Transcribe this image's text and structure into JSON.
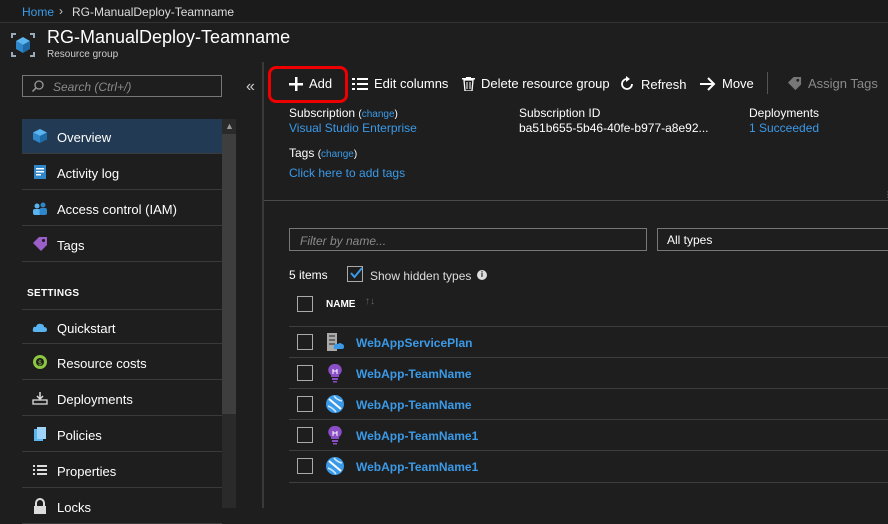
{
  "breadcrumb": {
    "home": "Home",
    "separator": "›",
    "current": "RG-ManualDeploy-Teamname"
  },
  "header": {
    "title": "RG-ManualDeploy-Teamname",
    "subtitle": "Resource group"
  },
  "sidebar": {
    "search_placeholder": "Search (Ctrl+/)",
    "collapse_glyph": "«",
    "settings_heading": "SETTINGS",
    "items": [
      {
        "label": "Overview",
        "icon": "overview-cube-icon",
        "active": true
      },
      {
        "label": "Activity log",
        "icon": "activity-log-icon"
      },
      {
        "label": "Access control (IAM)",
        "icon": "iam-users-icon"
      },
      {
        "label": "Tags",
        "icon": "tag-icon"
      },
      {
        "label": "Quickstart",
        "icon": "cloud-quickstart-icon"
      },
      {
        "label": "Resource costs",
        "icon": "resource-costs-icon"
      },
      {
        "label": "Deployments",
        "icon": "deployments-icon"
      },
      {
        "label": "Policies",
        "icon": "policies-icon"
      },
      {
        "label": "Properties",
        "icon": "properties-icon"
      },
      {
        "label": "Locks",
        "icon": "lock-icon"
      }
    ]
  },
  "toolbar": {
    "add": "Add",
    "edit_columns": "Edit columns",
    "delete_rg": "Delete resource group",
    "refresh": "Refresh",
    "move": "Move",
    "assign_tags": "Assign Tags"
  },
  "essentials": {
    "subscription_label": "Subscription",
    "subscription_change": "change",
    "subscription_value": "Visual Studio Enterprise",
    "subscription_id_label": "Subscription ID",
    "subscription_id_value": "ba51b655-5b46-40fe-b977-a8e92...",
    "deployments_label": "Deployments",
    "deployments_value": "1 Succeeded",
    "tags_label": "Tags",
    "tags_change": "change",
    "tags_link": "Click here to add tags"
  },
  "filter": {
    "placeholder": "Filter by name...",
    "types_selected": "All types"
  },
  "list": {
    "count": "5 items",
    "show_hidden_label": "Show hidden types",
    "show_hidden_checked": true,
    "name_header": "NAME",
    "rows": [
      {
        "name": "WebAppServicePlan",
        "icon": "app-service-plan-icon"
      },
      {
        "name": "WebApp-TeamName",
        "icon": "app-insights-bulb-icon"
      },
      {
        "name": "WebApp-TeamName",
        "icon": "web-app-globe-icon"
      },
      {
        "name": "WebApp-TeamName1",
        "icon": "app-insights-bulb-icon"
      },
      {
        "name": "WebApp-TeamName1",
        "icon": "web-app-globe-icon"
      }
    ]
  },
  "colors": {
    "accent_link": "#3b9ae8",
    "highlight": "#ee0000",
    "active_nav": "#233a54",
    "background": "#1e1e1e"
  }
}
